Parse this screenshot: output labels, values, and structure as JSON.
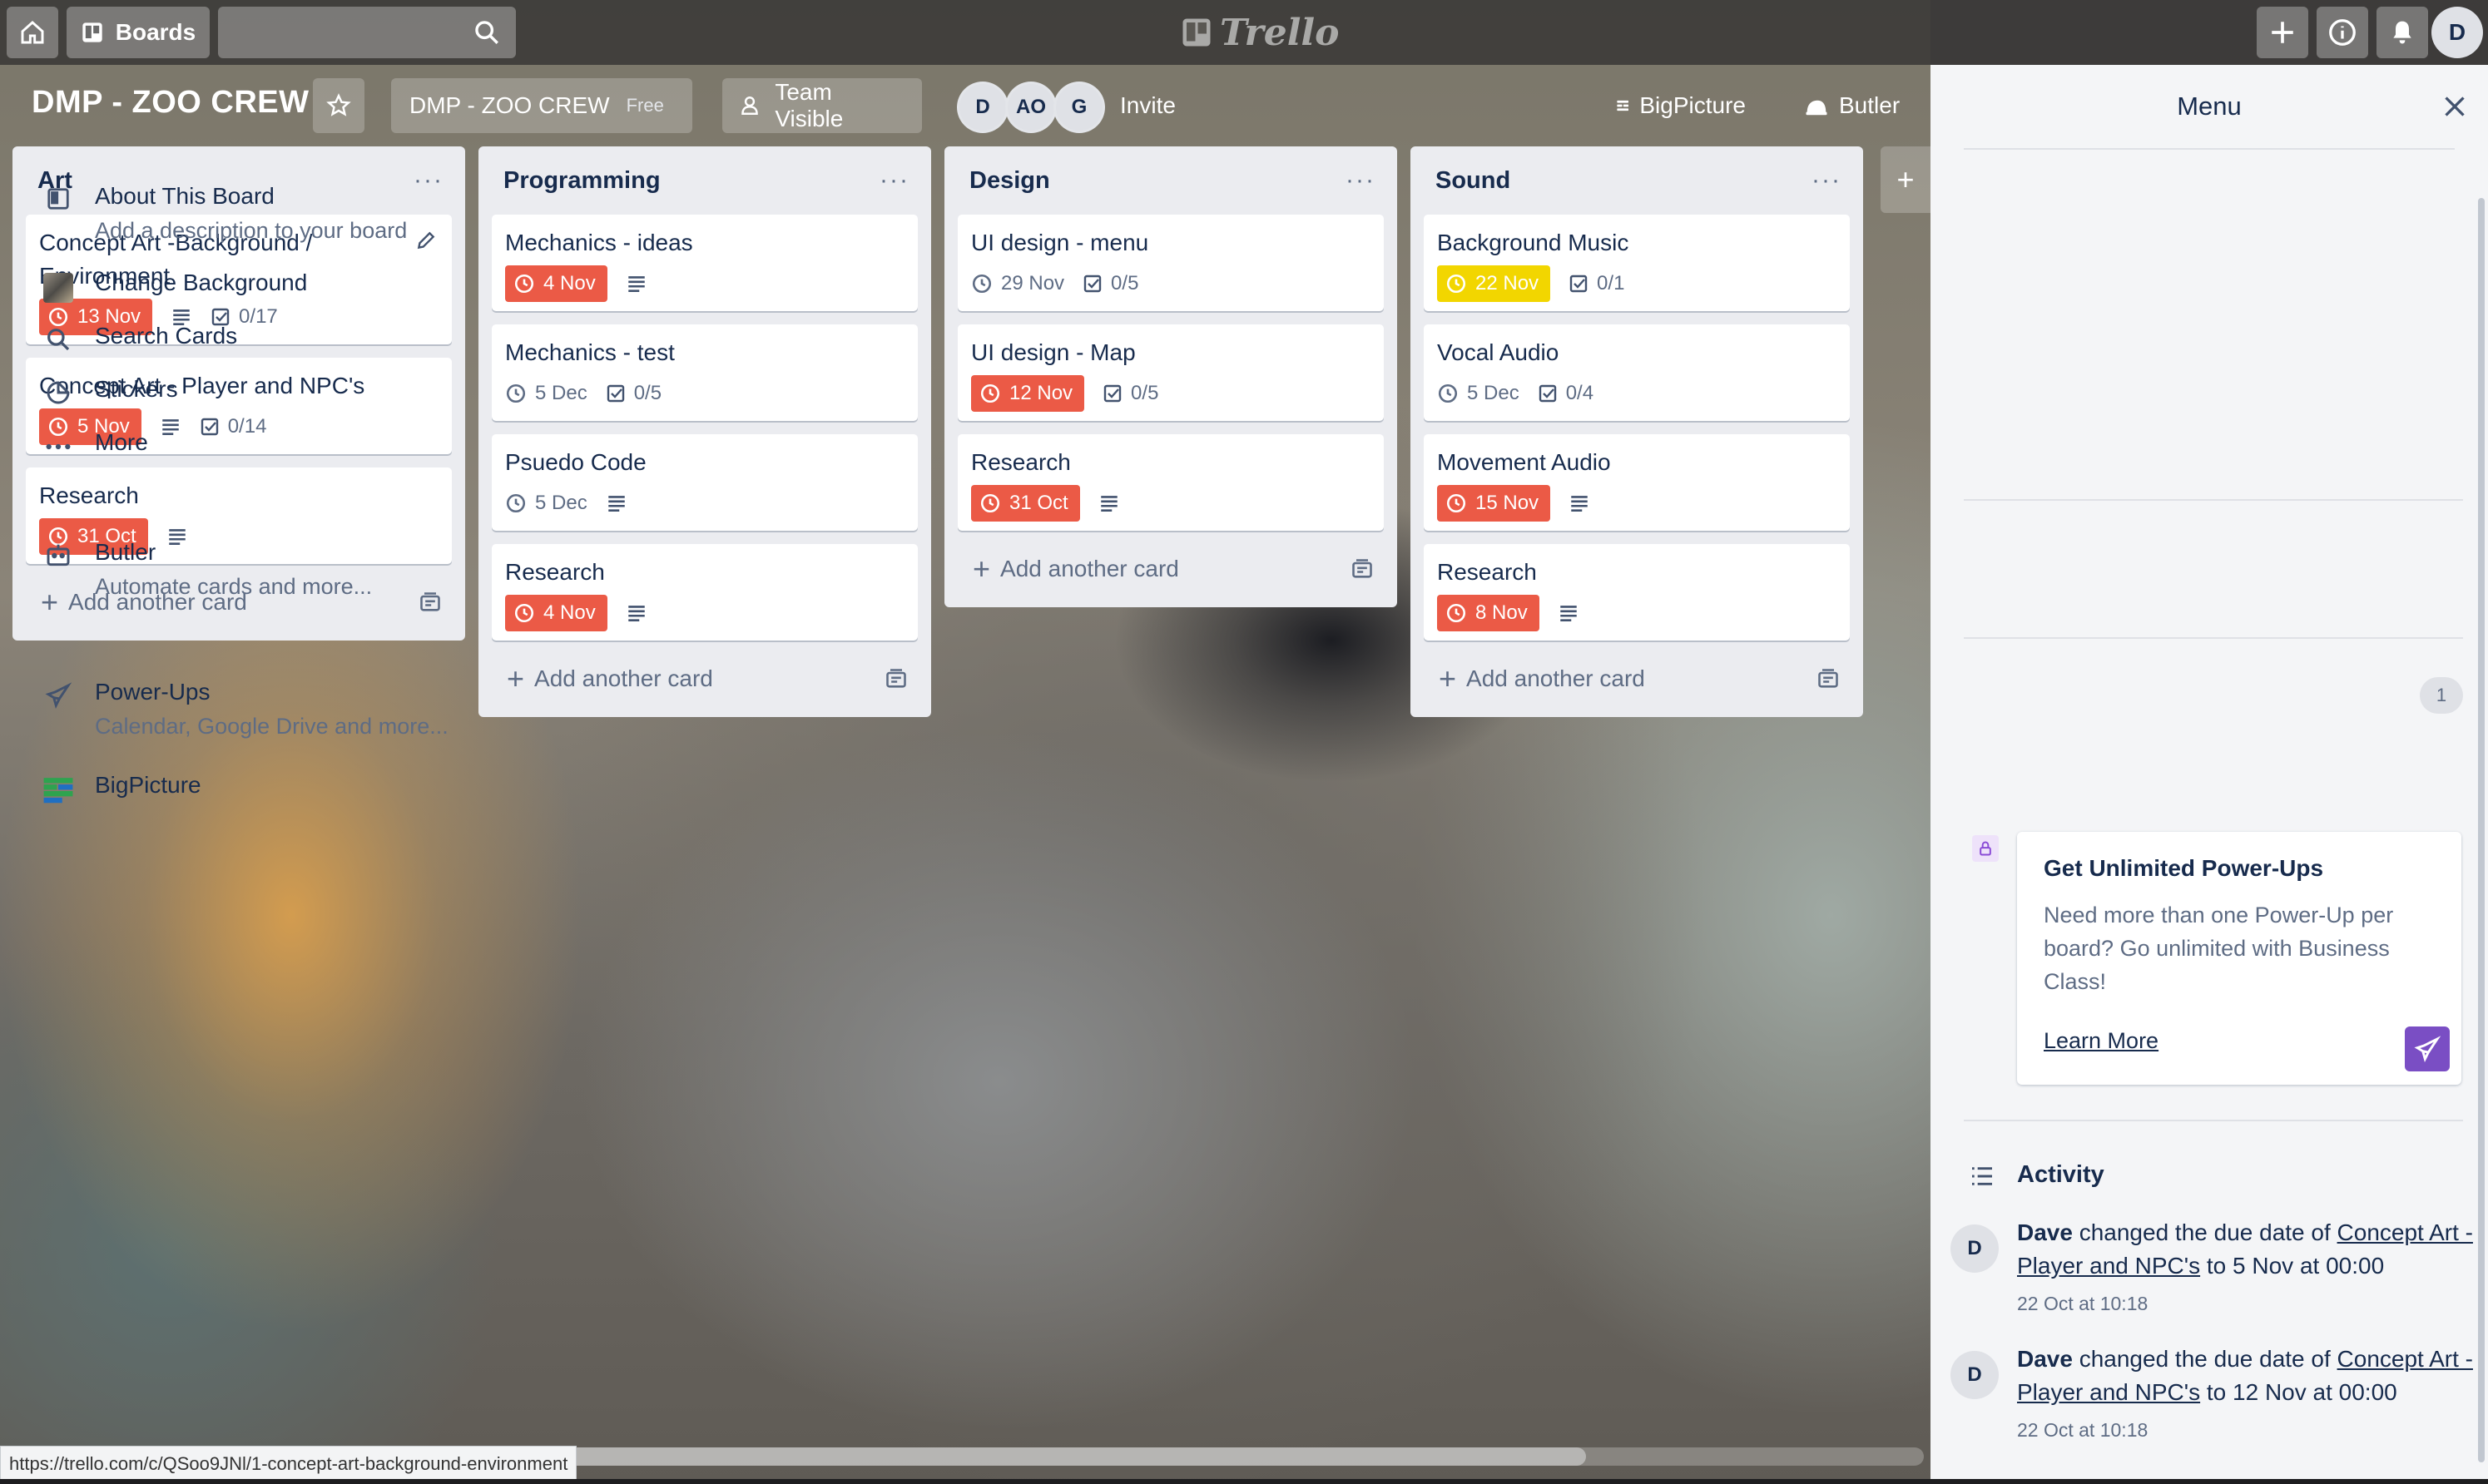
{
  "topbar": {
    "boards_label": "Boards",
    "logo_text": "Trello",
    "avatar_initial": "D"
  },
  "board": {
    "title": "DMP - ZOO CREW",
    "team_name": "DMP - ZOO CREW",
    "team_plan": "Free",
    "visibility": "Team Visible",
    "members": [
      "D",
      "AO",
      "G"
    ],
    "invite_label": "Invite",
    "bigpicture_label": "BigPicture",
    "butler_label": "Butler"
  },
  "lists": [
    {
      "title": "Art",
      "cards": [
        {
          "title": "Concept Art -Background / Environment",
          "due": "13 Nov",
          "due_style": "red",
          "desc": true,
          "checklist": "0/17"
        },
        {
          "title": "Concept Art - Player and NPC's",
          "due": "5 Nov",
          "due_style": "red",
          "desc": true,
          "checklist": "0/14"
        },
        {
          "title": "Research",
          "due": "31 Oct",
          "due_style": "red",
          "desc": true,
          "checklist": ""
        }
      ],
      "add_label": "Add another card"
    },
    {
      "title": "Programming",
      "cards": [
        {
          "title": "Mechanics - ideas",
          "due": "4 Nov",
          "due_style": "red",
          "desc": true,
          "checklist": ""
        },
        {
          "title": "Mechanics - test",
          "due": "5 Dec",
          "due_style": "plain",
          "desc": false,
          "checklist": "0/5"
        },
        {
          "title": "Psuedo Code",
          "due": "5 Dec",
          "due_style": "plain",
          "desc": true,
          "checklist": ""
        },
        {
          "title": "Research",
          "due": "4 Nov",
          "due_style": "red",
          "desc": true,
          "checklist": ""
        }
      ],
      "add_label": "Add another card"
    },
    {
      "title": "Design",
      "cards": [
        {
          "title": "UI design - menu",
          "due": "29 Nov",
          "due_style": "plain",
          "desc": false,
          "checklist": "0/5"
        },
        {
          "title": "UI design - Map",
          "due": "12 Nov",
          "due_style": "red",
          "desc": false,
          "checklist": "0/5"
        },
        {
          "title": "Research",
          "due": "31 Oct",
          "due_style": "red",
          "desc": true,
          "checklist": ""
        }
      ],
      "add_label": "Add another card"
    },
    {
      "title": "Sound",
      "cards": [
        {
          "title": "Background Music",
          "due": "22 Nov",
          "due_style": "yellow",
          "desc": false,
          "checklist": "0/1"
        },
        {
          "title": "Vocal Audio",
          "due": "5 Dec",
          "due_style": "plain",
          "desc": false,
          "checklist": "0/4"
        },
        {
          "title": "Movement Audio",
          "due": "15 Nov",
          "due_style": "red",
          "desc": true,
          "checklist": ""
        },
        {
          "title": "Research",
          "due": "8 Nov",
          "due_style": "red",
          "desc": true,
          "checklist": ""
        }
      ],
      "add_label": "Add another card"
    }
  ],
  "menu": {
    "title": "Menu",
    "about_title": "About This Board",
    "about_sub": "Add a description to your board",
    "change_bg": "Change Background",
    "search_cards": "Search Cards",
    "stickers": "Stickers",
    "more": "More",
    "butler_title": "Butler",
    "butler_sub": "Automate cards and more...",
    "powerups_title": "Power-Ups",
    "powerups_sub": "Calendar, Google Drive and more...",
    "powerups_count": "1",
    "bigpicture": "BigPicture",
    "promo_title": "Get Unlimited Power-Ups",
    "promo_body": "Need more than one Power-Up per board? Go unlimited with Business Class!",
    "promo_link": "Learn More",
    "activity_title": "Activity",
    "activity": [
      {
        "avatar": "D",
        "user": "Dave",
        "action": "changed the due date of",
        "card": "Concept Art - Player and NPC's",
        "to": "to 5 Nov at 00:00",
        "time": "22 Oct at 10:18"
      },
      {
        "avatar": "D",
        "user": "Dave",
        "action": "changed the due date of",
        "card": "Concept Art - Player and NPC's",
        "to": "to 12 Nov at 00:00",
        "time": "22 Oct at 10:18"
      }
    ]
  },
  "status_url": "https://trello.com/c/QSoo9JNl/1-concept-art-background-environment"
}
